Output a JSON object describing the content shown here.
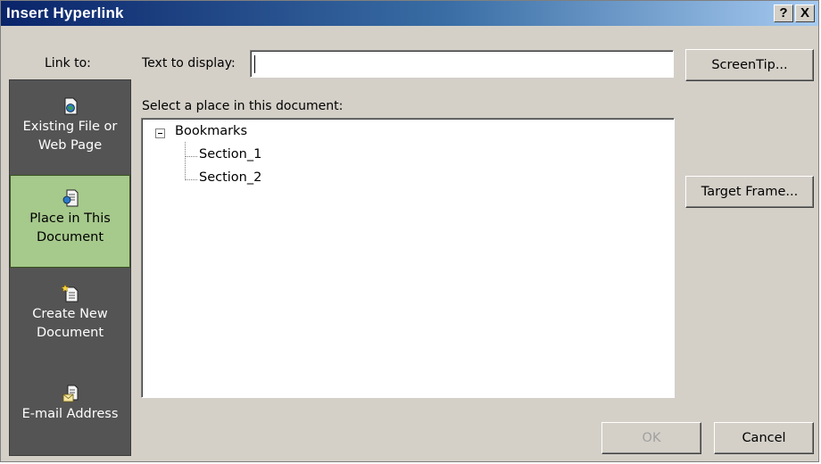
{
  "window": {
    "title": "Insert Hyperlink",
    "help_glyph": "?",
    "close_glyph": "X"
  },
  "link_to": {
    "label": "Link to:",
    "items": [
      {
        "line1": "Existing File or",
        "line2": "Web Page",
        "icon": "existing-file-icon",
        "selected": false
      },
      {
        "line1": "Place in This",
        "line2": "Document",
        "icon": "place-in-document-icon",
        "selected": true
      },
      {
        "line1": "Create New",
        "line2": "Document",
        "icon": "new-document-icon",
        "selected": false
      },
      {
        "line1": "E-mail Address",
        "line2": "",
        "icon": "email-address-icon",
        "selected": false
      }
    ]
  },
  "text_to_display": {
    "label": "Text to display:",
    "value": ""
  },
  "place": {
    "label": "Select a place in this document:",
    "tree": {
      "root": "Bookmarks",
      "expander": "minus",
      "children": [
        "Section_1",
        "Section_2"
      ]
    }
  },
  "buttons": {
    "screentip": "ScreenTip...",
    "target_frame": "Target Frame...",
    "ok": "OK",
    "cancel": "Cancel"
  },
  "colors": {
    "title_gradient_start": "#0a246a",
    "dialog_bg": "#d4d0c8",
    "sidebar_bg": "#545454",
    "selected_item_bg": "#a6c98c"
  }
}
